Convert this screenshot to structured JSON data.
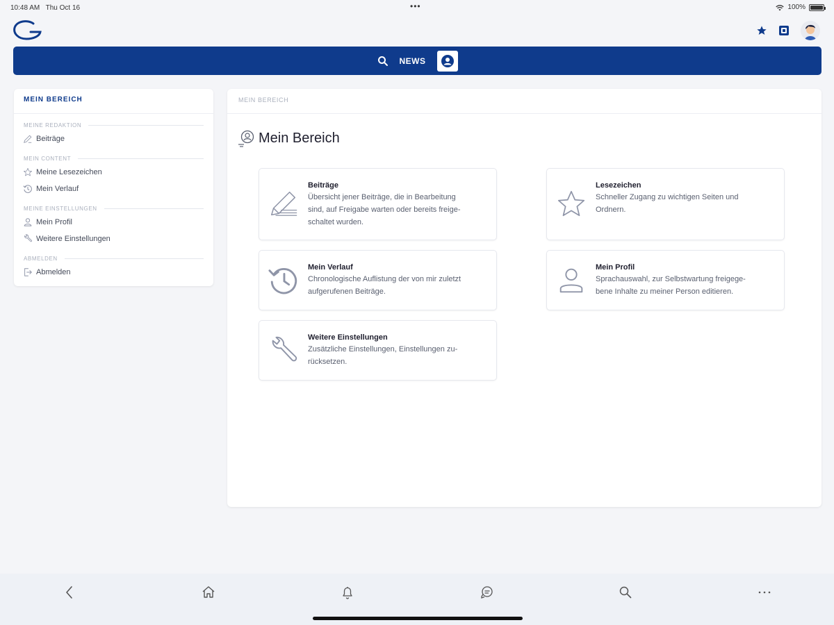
{
  "status_bar": {
    "time": "10:48 AM",
    "date": "Thu Oct 16",
    "battery": "100%",
    "battery_level": 1.0
  },
  "navbar": {
    "news_label": "NEWS"
  },
  "sidebar": {
    "title": "MEIN BEREICH",
    "sections": [
      {
        "label": "MEINE REDAKTION",
        "items": [
          {
            "label": "Beiträge",
            "icon": "pencil-icon"
          }
        ]
      },
      {
        "label": "MEIN CONTENT",
        "items": [
          {
            "label": "Meine Lesezeichen",
            "icon": "star-icon"
          },
          {
            "label": "Mein Verlauf",
            "icon": "history-icon"
          }
        ]
      },
      {
        "label": "MEINE EINSTELLUNGEN",
        "items": [
          {
            "label": "Mein Profil",
            "icon": "user-icon"
          },
          {
            "label": "Weitere Einstellungen",
            "icon": "wrench-icon"
          }
        ]
      },
      {
        "label": "ABMELDEN",
        "items": [
          {
            "label": "Abmelden",
            "icon": "logout-icon"
          }
        ]
      }
    ]
  },
  "main": {
    "breadcrumb": "MEIN BEREICH",
    "title": "Mein Bereich",
    "cards": [
      {
        "title": "Beiträge",
        "icon": "pencil-icon",
        "desc": [
          "Übersicht jener Beiträge, die in Bearbeitung",
          "sind, auf Freigabe warten oder bereits freige-",
          "schaltet wurden."
        ]
      },
      {
        "title": "Lesezeichen",
        "icon": "star-icon",
        "desc": [
          "Schneller Zugang zu wichtigen Seiten und",
          "Ordnern."
        ]
      },
      {
        "title": "Mein Verlauf",
        "icon": "history-icon",
        "desc": [
          "Chronologische Auflistung der von mir zuletzt",
          "aufgerufenen Beiträge."
        ]
      },
      {
        "title": "Mein Profil",
        "icon": "user-icon",
        "desc": [
          "Sprachauswahl, zur Selbstwartung freigege-",
          "bene Inhalte zu meiner Person editieren."
        ]
      },
      {
        "title": "Weitere Einstellungen",
        "icon": "wrench-icon",
        "desc": [
          "Zusätzliche Einstellungen, Einstellungen zu-",
          "rücksetzen."
        ]
      }
    ]
  },
  "bottom_bar": {
    "icons": [
      "back-icon",
      "home-icon",
      "bell-icon",
      "chat-icon",
      "search-icon",
      "more-icon"
    ]
  },
  "colors": {
    "brand": "#0f3b8c",
    "background": "#f4f5f8",
    "icon_gray": "#8f95a8"
  }
}
